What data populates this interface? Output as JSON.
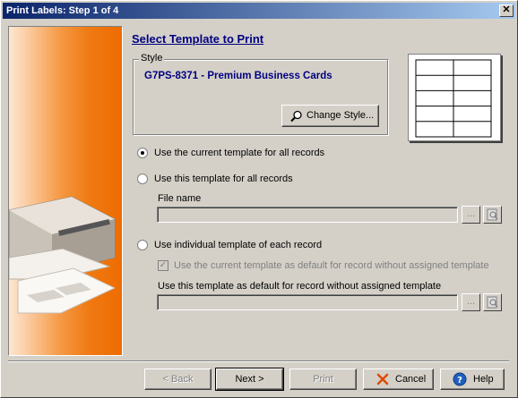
{
  "window": {
    "title": "Print Labels: Step 1 of 4",
    "close_glyph": "✕"
  },
  "heading": "Select Template to Print",
  "style_group": {
    "legend": "Style",
    "value": "G7PS-8371 - Premium Business Cards",
    "change_button": "Change Style..."
  },
  "options": {
    "current": "Use the current template for all records",
    "this": "Use this template for all records",
    "file_name_label": "File name",
    "individual": "Use individual template of each record",
    "default_checkbox": "Use the current template as default for record without assigned template",
    "default_field_label": "Use this template as default for record without assigned template",
    "browse_glyph": "..."
  },
  "buttons": {
    "back": "< Back",
    "next": "Next >",
    "print": "Print",
    "cancel": "Cancel",
    "help": "Help"
  },
  "colors": {
    "heading": "#000080",
    "panel_orange": "#f07a14",
    "title_bar": "#0a246a"
  }
}
